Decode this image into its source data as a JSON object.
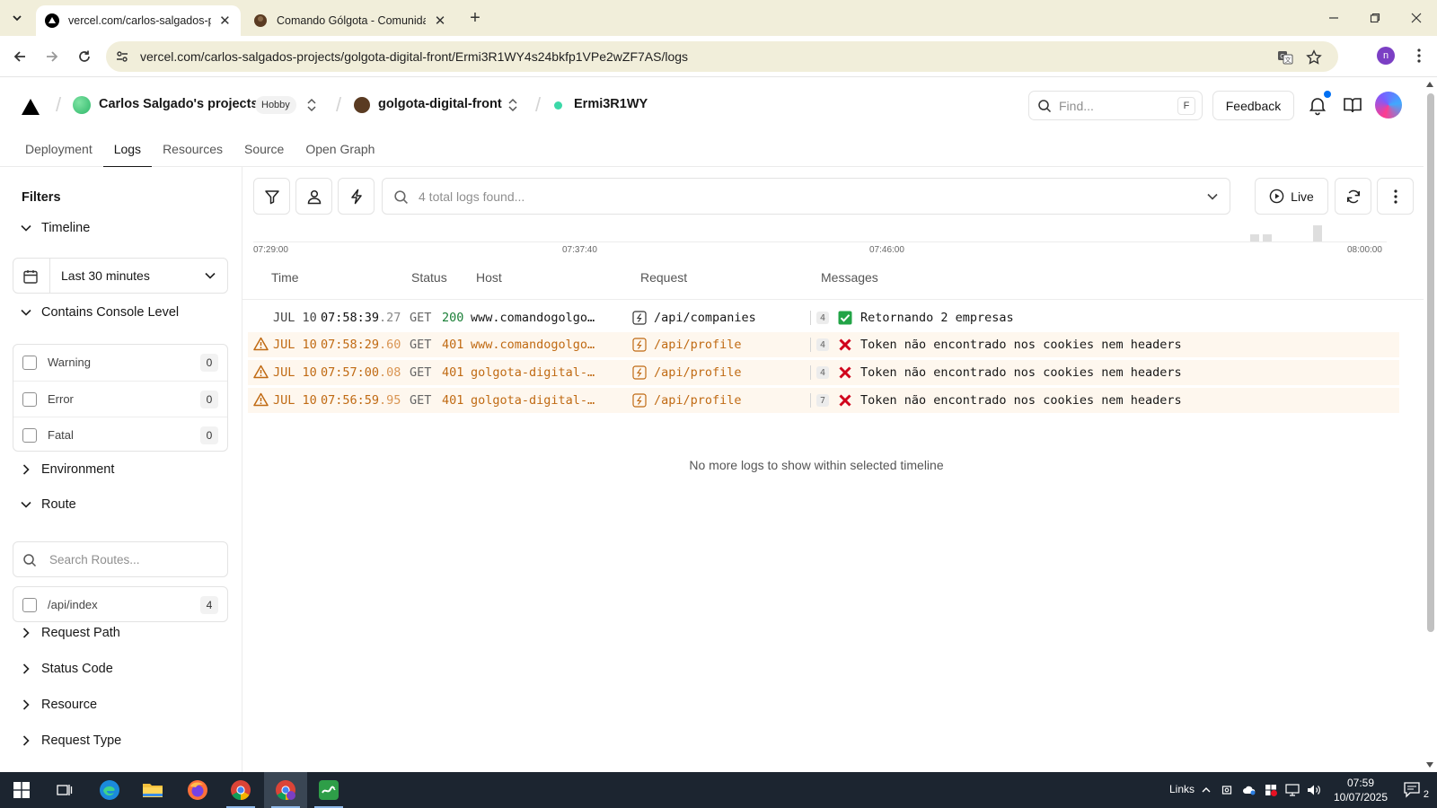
{
  "browser": {
    "tabs": [
      {
        "title": "vercel.com/carlos-salgados-pro",
        "active": true
      },
      {
        "title": "Comando Gólgota - Comunidade",
        "active": false
      }
    ],
    "url": "vercel.com/carlos-salgados-projects/golgota-digital-front/Ermi3R1WY4s24bkfp1VPe2wZF7AS/logs",
    "profile_initial": "n"
  },
  "header": {
    "team_name": "Carlos Salgado's projects",
    "plan_badge": "Hobby",
    "project_name": "golgota-digital-front",
    "deployment_id": "Ermi3R1WY",
    "find_placeholder": "Find...",
    "find_shortcut": "F",
    "feedback_label": "Feedback",
    "tabs": [
      "Deployment",
      "Logs",
      "Resources",
      "Source",
      "Open Graph"
    ],
    "active_tab": "Logs"
  },
  "sidebar": {
    "title": "Filters",
    "timeline": {
      "label": "Timeline",
      "value": "Last 30 minutes"
    },
    "console_level": {
      "label": "Contains Console Level",
      "levels": [
        {
          "label": "Warning",
          "count": "0"
        },
        {
          "label": "Error",
          "count": "0"
        },
        {
          "label": "Fatal",
          "count": "0"
        }
      ]
    },
    "environment_label": "Environment",
    "route": {
      "label": "Route",
      "search_placeholder": "Search Routes...",
      "items": [
        {
          "label": "/api/index",
          "count": "4"
        }
      ]
    },
    "more_sections": [
      "Request Path",
      "Status Code",
      "Resource",
      "Request Type"
    ]
  },
  "logs": {
    "search_placeholder": "4 total logs found...",
    "live_label": "Live",
    "timeline_ticks": [
      "07:29:00",
      "07:37:40",
      "07:46:00",
      "08:00:00"
    ],
    "histogram_levels": [
      0.25,
      0.25,
      0.6
    ],
    "columns": [
      "Time",
      "Status",
      "Host",
      "Request",
      "Messages"
    ],
    "rows": [
      {
        "level": "info",
        "date": "JUL 10",
        "time": "07:58:39",
        "ms": ".27",
        "method": "GET",
        "status": "200",
        "host": "www.comandogolgota.com.br",
        "path": "/api/companies",
        "msg_count": "4",
        "msg_kind": "check",
        "message": "Retornando 2 empresas"
      },
      {
        "level": "warning",
        "date": "JUL 10",
        "time": "07:58:29",
        "ms": ".60",
        "method": "GET",
        "status": "401",
        "host": "www.comandogolgota.com.br",
        "path": "/api/profile",
        "msg_count": "4",
        "msg_kind": "cross",
        "message": "Token não encontrado nos cookies nem headers"
      },
      {
        "level": "warning",
        "date": "JUL 10",
        "time": "07:57:00",
        "ms": ".08",
        "method": "GET",
        "status": "401",
        "host": "golgota-digital-front.vercel.app",
        "path": "/api/profile",
        "msg_count": "4",
        "msg_kind": "cross",
        "message": "Token não encontrado nos cookies nem headers"
      },
      {
        "level": "warning",
        "date": "JUL 10",
        "time": "07:56:59",
        "ms": ".95",
        "method": "GET",
        "status": "401",
        "host": "golgota-digital-front.vercel.app",
        "path": "/api/profile",
        "msg_count": "7",
        "msg_kind": "cross",
        "message": "Token não encontrado nos cookies nem headers"
      }
    ],
    "end_message": "No more logs to show within selected timeline"
  },
  "taskbar": {
    "links_label": "Links",
    "time": "07:59",
    "date": "10/07/2025",
    "notification_count": "2"
  },
  "colors": {
    "warning": "#c06a13",
    "warning_row_bg": "#fef7ee",
    "success": "#1a7f37",
    "error_cross": "#d0021b",
    "check_green": "#22a447"
  }
}
